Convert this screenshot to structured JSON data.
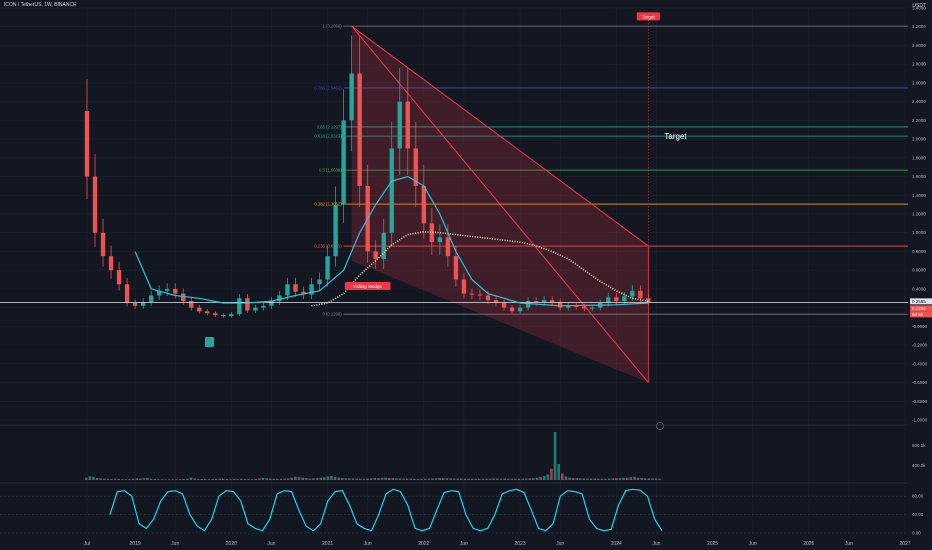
{
  "header": {
    "symbol": "ICON / TetherUS, 1W, BINANCE",
    "currency": "USDT"
  },
  "colors": {
    "background": "#131722",
    "bull": "#26a69a",
    "bear": "#ef5350",
    "wedge_fill": "#f2364533",
    "wedge_line": "#f23645",
    "ema_slow": "#f5deb3",
    "ema_fast": "#26c6da",
    "rsi": "#22d3ee",
    "grid": "#1e222d",
    "axis_text": "#b2b5be"
  },
  "chart_data": [
    {
      "type": "candlestick",
      "title": "ICON / TetherUS, 1W, BINANCE",
      "ylim": [
        -1.0,
        3.4
      ],
      "y_ticks": [
        3.4,
        3.2,
        3.0,
        2.8,
        2.6,
        2.4,
        2.2,
        2.0,
        1.8,
        1.6,
        1.4,
        1.2,
        1.0,
        0.8,
        0.6,
        0.4,
        0.2,
        0.0,
        -0.2,
        -0.4,
        -0.6,
        -0.8,
        -1.0
      ],
      "y_tick_labels": [
        "3.4000",
        "3.2000",
        "3.0000",
        "2.8000",
        "2.6000",
        "2.4000",
        "2.2000",
        "2.0000",
        "1.8000",
        "1.6000",
        "1.4000",
        "1.2000",
        "1.0000",
        "0.8000",
        "0.6000",
        "0.4000",
        "0.2000",
        "-0.0000",
        "-0.2000",
        "-0.4000",
        "-0.6000",
        "-0.8000",
        "-1.0000"
      ],
      "x_ticks": [
        "Jul",
        "2019",
        "Jun",
        "2020",
        "Jun",
        "2021",
        "Jun",
        "2022",
        "Jun",
        "2023",
        "Jun",
        "2024",
        "Jun",
        "2025",
        "Jun",
        "2026",
        "Jun",
        "2027"
      ],
      "x_tick_dates": [
        "2018-07",
        "2019-01",
        "2019-06",
        "2020-01",
        "2020-06",
        "2021-01",
        "2021-06",
        "2022-01",
        "2022-06",
        "2023-01",
        "2023-06",
        "2024-01",
        "2024-06",
        "2025-01",
        "2025-06",
        "2026-01",
        "2026-06",
        "2027-01"
      ],
      "last_price": "0.2565",
      "price_markers": [
        "0.2565",
        "0.2294",
        "5d 6h"
      ],
      "price_series": [
        [
          "2018-06",
          2.3
        ],
        [
          "2018-07",
          1.6
        ],
        [
          "2018-08",
          1.0
        ],
        [
          "2018-09",
          0.75
        ],
        [
          "2018-10",
          0.6
        ],
        [
          "2018-11",
          0.45
        ],
        [
          "2018-12",
          0.25
        ],
        [
          "2019-01",
          0.22
        ],
        [
          "2019-02",
          0.26
        ],
        [
          "2019-03",
          0.33
        ],
        [
          "2019-04",
          0.38
        ],
        [
          "2019-05",
          0.4
        ],
        [
          "2019-06",
          0.35
        ],
        [
          "2019-07",
          0.27
        ],
        [
          "2019-08",
          0.2
        ],
        [
          "2019-09",
          0.16
        ],
        [
          "2019-10",
          0.14
        ],
        [
          "2019-11",
          0.12
        ],
        [
          "2019-12",
          0.11
        ],
        [
          "2020-01",
          0.13
        ],
        [
          "2020-02",
          0.3
        ],
        [
          "2020-03",
          0.17
        ],
        [
          "2020-04",
          0.2
        ],
        [
          "2020-05",
          0.22
        ],
        [
          "2020-06",
          0.27
        ],
        [
          "2020-07",
          0.33
        ],
        [
          "2020-08",
          0.45
        ],
        [
          "2020-09",
          0.37
        ],
        [
          "2020-10",
          0.34
        ],
        [
          "2020-11",
          0.45
        ],
        [
          "2020-12",
          0.5
        ],
        [
          "2021-01",
          0.75
        ],
        [
          "2021-02",
          1.3
        ],
        [
          "2021-03",
          2.2
        ],
        [
          "2021-04",
          2.7
        ],
        [
          "2021-05",
          1.5
        ],
        [
          "2021-06",
          0.8
        ],
        [
          "2021-07",
          0.72
        ],
        [
          "2021-08",
          1.0
        ],
        [
          "2021-09",
          1.9
        ],
        [
          "2021-10",
          2.4
        ],
        [
          "2021-11",
          1.9
        ],
        [
          "2021-12",
          1.5
        ],
        [
          "2022-01",
          1.1
        ],
        [
          "2022-02",
          0.9
        ],
        [
          "2022-03",
          0.95
        ],
        [
          "2022-04",
          0.75
        ],
        [
          "2022-05",
          0.5
        ],
        [
          "2022-06",
          0.35
        ],
        [
          "2022-07",
          0.34
        ],
        [
          "2022-08",
          0.33
        ],
        [
          "2022-09",
          0.28
        ],
        [
          "2022-10",
          0.25
        ],
        [
          "2022-11",
          0.2
        ],
        [
          "2022-12",
          0.16
        ],
        [
          "2023-01",
          0.2
        ],
        [
          "2023-02",
          0.27
        ],
        [
          "2023-03",
          0.26
        ],
        [
          "2023-04",
          0.28
        ],
        [
          "2023-05",
          0.26
        ],
        [
          "2023-06",
          0.2
        ],
        [
          "2023-07",
          0.22
        ],
        [
          "2023-08",
          0.21
        ],
        [
          "2023-09",
          0.19
        ],
        [
          "2023-10",
          0.2
        ],
        [
          "2023-11",
          0.25
        ],
        [
          "2023-12",
          0.31
        ],
        [
          "2024-01",
          0.27
        ],
        [
          "2024-02",
          0.32
        ],
        [
          "2024-03",
          0.38
        ],
        [
          "2024-04",
          0.3
        ],
        [
          "2024-05",
          0.2565
        ]
      ],
      "ema_slow": [
        [
          "2020-11",
          0.22
        ],
        [
          "2021-01",
          0.25
        ],
        [
          "2021-03",
          0.35
        ],
        [
          "2021-05",
          0.55
        ],
        [
          "2021-07",
          0.7
        ],
        [
          "2021-09",
          0.87
        ],
        [
          "2021-11",
          0.98
        ],
        [
          "2022-01",
          1.01
        ],
        [
          "2022-03",
          1.0
        ],
        [
          "2022-05",
          0.98
        ],
        [
          "2022-07",
          0.96
        ],
        [
          "2022-09",
          0.94
        ],
        [
          "2022-11",
          0.92
        ],
        [
          "2023-01",
          0.9
        ],
        [
          "2023-03",
          0.86
        ],
        [
          "2023-05",
          0.8
        ],
        [
          "2023-07",
          0.72
        ],
        [
          "2023-09",
          0.6
        ],
        [
          "2023-11",
          0.48
        ],
        [
          "2024-01",
          0.38
        ],
        [
          "2024-03",
          0.3
        ],
        [
          "2024-05",
          0.27
        ]
      ],
      "ema_fast": [
        [
          "2019-01",
          0.8
        ],
        [
          "2019-03",
          0.4
        ],
        [
          "2019-06",
          0.33
        ],
        [
          "2019-09",
          0.3
        ],
        [
          "2019-12",
          0.25
        ],
        [
          "2020-03",
          0.25
        ],
        [
          "2020-06",
          0.27
        ],
        [
          "2020-09",
          0.33
        ],
        [
          "2020-12",
          0.38
        ],
        [
          "2021-03",
          0.6
        ],
        [
          "2021-05",
          1.0
        ],
        [
          "2021-07",
          1.3
        ],
        [
          "2021-09",
          1.55
        ],
        [
          "2021-11",
          1.6
        ],
        [
          "2022-01",
          1.5
        ],
        [
          "2022-03",
          1.2
        ],
        [
          "2022-05",
          0.8
        ],
        [
          "2022-07",
          0.5
        ],
        [
          "2022-09",
          0.35
        ],
        [
          "2023-01",
          0.25
        ],
        [
          "2023-06",
          0.22
        ],
        [
          "2024-01",
          0.23
        ],
        [
          "2024-05",
          0.25
        ]
      ],
      "fib_levels": [
        {
          "label": "1 (3.2066)",
          "value": 3.2066
        },
        {
          "label": "0.786 (2.5462)",
          "value": 2.5462
        },
        {
          "label": "0.65 (2.1297)",
          "value": 2.1297
        },
        {
          "label": "0.618 (2.0313)",
          "value": 2.0313
        },
        {
          "label": "0.5 (1.6688)",
          "value": 1.6688
        },
        {
          "label": "0.382 (1.3062)",
          "value": 1.3062
        },
        {
          "label": "0.236 (0.8575)",
          "value": 0.8575
        },
        {
          "label": "0 (0.1298)",
          "value": 0.1298
        }
      ],
      "annotations": [
        {
          "text": "Target",
          "date": "2024-05",
          "value": 3.3
        },
        {
          "text": "Target",
          "date": "2024-07",
          "value": 2.0
        },
        {
          "text": "Falling Wedge",
          "date": "2021-06",
          "value": 0.42
        }
      ],
      "falling_wedge": {
        "upper": [
          [
            "2021-04",
            3.2066
          ],
          [
            "2024-05",
            0.8575
          ]
        ],
        "lower": [
          [
            "2021-04",
            0.7
          ],
          [
            "2024-05",
            -0.6
          ]
        ]
      }
    },
    {
      "type": "bar",
      "title": "Volume",
      "y_tick_labels": [
        "800.0k",
        "400.0k"
      ],
      "volume_values": [
        60,
        90,
        80,
        50,
        40,
        30,
        30,
        25,
        30,
        25,
        20,
        20,
        20,
        30,
        40,
        35,
        45,
        55,
        30,
        25,
        20,
        18,
        15,
        16,
        18,
        20,
        22,
        25,
        35,
        60,
        40,
        30,
        25,
        22,
        20,
        25,
        30,
        35,
        30,
        25,
        20,
        30,
        28,
        30,
        26,
        22,
        20,
        25,
        40,
        55,
        45,
        35,
        30,
        28,
        30,
        35,
        40,
        60,
        80,
        70,
        60,
        50,
        40,
        45,
        50,
        60,
        70,
        90,
        100,
        80,
        60,
        50,
        45,
        40,
        38,
        35,
        30,
        32,
        35,
        40,
        45,
        50,
        55,
        60,
        50,
        45,
        40,
        38,
        36,
        35,
        33,
        30,
        28,
        30,
        32,
        35,
        40,
        45,
        50,
        48,
        45,
        40,
        38,
        36,
        35,
        33,
        32,
        30,
        30,
        28,
        30,
        32,
        35,
        40,
        38,
        36,
        35,
        33,
        32,
        30,
        30,
        35,
        40,
        45,
        50,
        60,
        80,
        100,
        140,
        280,
        1200,
        400,
        160,
        90,
        60,
        50,
        45,
        40,
        38,
        36,
        35,
        33,
        32,
        30,
        30,
        35,
        40,
        45,
        50,
        55,
        60,
        70,
        80,
        60,
        50,
        45,
        40,
        38,
        36,
        35
      ]
    },
    {
      "type": "line",
      "title": "Stochastic RSI",
      "ylim": [
        0,
        100
      ],
      "y_ticks": [
        80.0,
        40.0,
        0.0
      ],
      "y_tick_labels": [
        "80.00",
        "40.00",
        "0.00"
      ],
      "rsi_values": [
        40,
        90,
        92,
        80,
        20,
        10,
        30,
        70,
        90,
        92,
        85,
        40,
        15,
        5,
        30,
        80,
        92,
        90,
        70,
        20,
        10,
        5,
        30,
        85,
        92,
        90,
        50,
        15,
        5,
        20,
        70,
        90,
        92,
        60,
        20,
        10,
        5,
        40,
        85,
        95,
        90,
        60,
        10,
        5,
        10,
        50,
        88,
        92,
        90,
        40,
        10,
        5,
        10,
        40,
        85,
        92,
        95,
        88,
        50,
        10,
        5,
        20,
        80,
        92,
        90,
        85,
        30,
        10,
        5,
        8,
        60,
        92,
        95,
        93,
        80,
        30,
        5
      ]
    }
  ]
}
